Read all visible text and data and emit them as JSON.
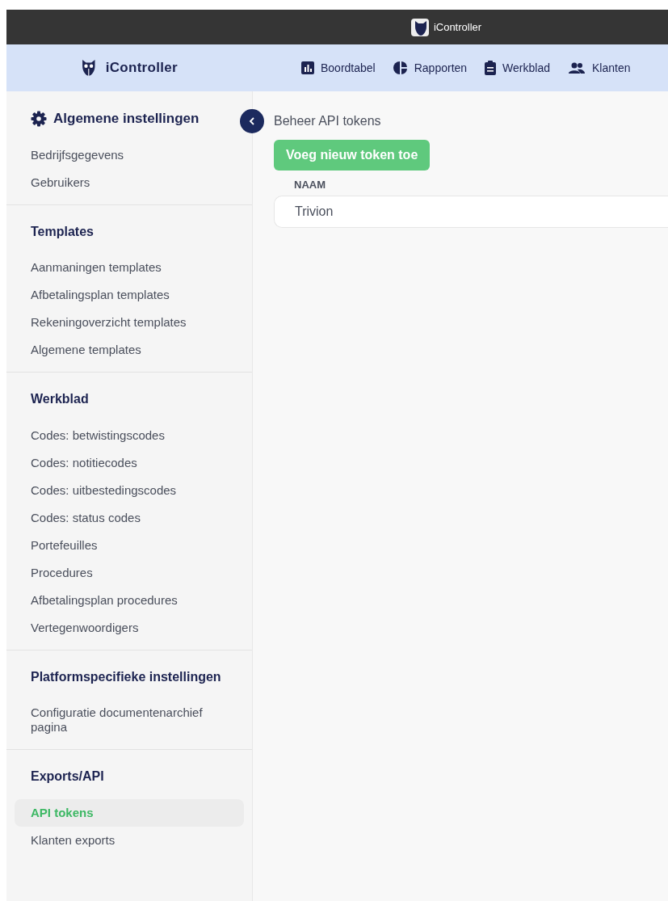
{
  "window": {
    "title": "iController"
  },
  "nav": {
    "brand": "iController",
    "items": [
      {
        "label": "Boordtabel",
        "kind": "chart"
      },
      {
        "label": "Rapporten",
        "kind": "pie"
      },
      {
        "label": "Werkblad",
        "kind": "clipboard"
      },
      {
        "label": "Klanten",
        "kind": "people"
      }
    ]
  },
  "sidebar": {
    "sections": [
      {
        "title": "Algemene instellingen",
        "kind": "settings",
        "items": [
          {
            "label": "Bedrijfsgegevens",
            "selected": false
          },
          {
            "label": "Gebruikers",
            "selected": false
          }
        ]
      },
      {
        "title": "Templates",
        "kind": "plain",
        "items": [
          {
            "label": "Aanmaningen templates",
            "selected": false
          },
          {
            "label": "Afbetalingsplan templates",
            "selected": false
          },
          {
            "label": "Rekeningoverzicht templates",
            "selected": false
          },
          {
            "label": "Algemene templates",
            "selected": false
          }
        ]
      },
      {
        "title": "Werkblad",
        "kind": "plain",
        "items": [
          {
            "label": "Codes: betwistingscodes",
            "selected": false
          },
          {
            "label": "Codes: notitiecodes",
            "selected": false
          },
          {
            "label": "Codes: uitbestedingscodes",
            "selected": false
          },
          {
            "label": "Codes: status codes",
            "selected": false
          },
          {
            "label": "Portefeuilles",
            "selected": false
          },
          {
            "label": "Procedures",
            "selected": false
          },
          {
            "label": "Afbetalingsplan procedures",
            "selected": false
          },
          {
            "label": "Vertegenwoordigers",
            "selected": false
          }
        ]
      },
      {
        "title": "Platformspecifieke instellingen",
        "kind": "plain",
        "items": [
          {
            "label": "Configuratie documentenarchief pagina",
            "selected": false
          }
        ]
      },
      {
        "title": "Exports/API",
        "kind": "plain",
        "items": [
          {
            "label": "API tokens",
            "selected": true
          },
          {
            "label": "Klanten exports",
            "selected": false
          }
        ]
      }
    ]
  },
  "main": {
    "title": "Beheer API tokens",
    "add_button": "Voeg nieuw token toe",
    "table": {
      "columns": [
        "NAAM"
      ],
      "rows": [
        [
          "Trivion"
        ]
      ]
    }
  }
}
